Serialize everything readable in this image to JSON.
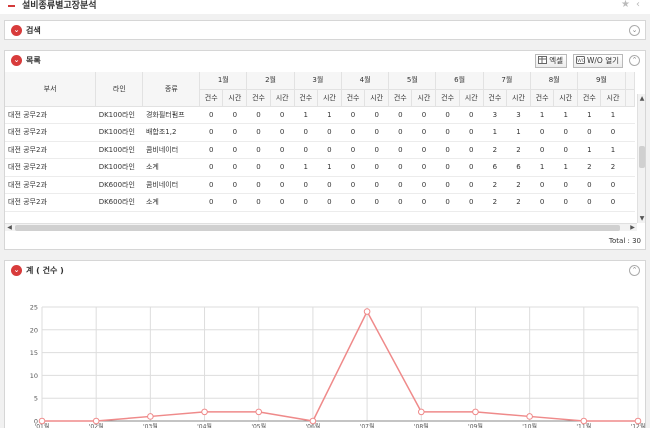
{
  "page": {
    "title": "설비종류별고장분석"
  },
  "search_panel": {
    "label": "검색"
  },
  "list_panel": {
    "label": "목록",
    "excel_label": "엑셀",
    "wo_label": "W/O 열기",
    "total_text": "Total : 30"
  },
  "table": {
    "headers": {
      "dept": "부서",
      "line": "라인",
      "kind": "종류"
    },
    "months": [
      "1월",
      "2월",
      "3월",
      "4월",
      "5월",
      "6월",
      "7월",
      "8월",
      "9월"
    ],
    "sub": [
      "건수",
      "시간"
    ],
    "rows": [
      {
        "dept": "대전 공무2과",
        "line": "DK100라인",
        "kind": "경화필터펌프",
        "v": [
          0,
          0,
          0,
          0,
          1,
          1,
          0,
          0,
          0,
          0,
          0,
          0,
          3,
          3,
          1,
          1,
          1,
          1
        ]
      },
      {
        "dept": "대전 공무2과",
        "line": "DK100라인",
        "kind": "배합조1,2",
        "v": [
          0,
          0,
          0,
          0,
          0,
          0,
          0,
          0,
          0,
          0,
          0,
          0,
          1,
          1,
          0,
          0,
          0,
          0
        ]
      },
      {
        "dept": "대전 공무2과",
        "line": "DK100라인",
        "kind": "콤비네이터",
        "v": [
          0,
          0,
          0,
          0,
          0,
          0,
          0,
          0,
          0,
          0,
          0,
          0,
          2,
          2,
          0,
          0,
          1,
          1
        ]
      },
      {
        "dept": "대전 공무2과",
        "line": "DK100라인",
        "kind": "소계",
        "v": [
          0,
          0,
          0,
          0,
          1,
          1,
          0,
          0,
          0,
          0,
          0,
          0,
          6,
          6,
          1,
          1,
          2,
          2
        ]
      },
      {
        "dept": "대전 공무2과",
        "line": "DK600라인",
        "kind": "콤비네이터",
        "v": [
          0,
          0,
          0,
          0,
          0,
          0,
          0,
          0,
          0,
          0,
          0,
          0,
          2,
          2,
          0,
          0,
          0,
          0
        ]
      },
      {
        "dept": "대전 공무2과",
        "line": "DK600라인",
        "kind": "소계",
        "v": [
          0,
          0,
          0,
          0,
          0,
          0,
          0,
          0,
          0,
          0,
          0,
          0,
          2,
          2,
          0,
          0,
          0,
          0
        ]
      }
    ]
  },
  "chart_panel": {
    "label": "계 ( 건수 )"
  },
  "chart_data": {
    "type": "line",
    "categories": [
      "'01월",
      "'02월",
      "'03월",
      "'04월",
      "'05월",
      "'06월",
      "'07월",
      "'08월",
      "'09월",
      "'10월",
      "'11월",
      "'12월"
    ],
    "values": [
      0,
      0,
      1,
      2,
      2,
      0,
      24,
      2,
      2,
      1,
      0,
      0
    ],
    "ylim": [
      0,
      25
    ],
    "yticks": [
      0,
      5,
      10,
      15,
      20,
      25
    ],
    "color": "#ef8a8a",
    "grid": true
  },
  "colors": {
    "accent": "#d83b3b",
    "line": "#ef8a8a"
  }
}
